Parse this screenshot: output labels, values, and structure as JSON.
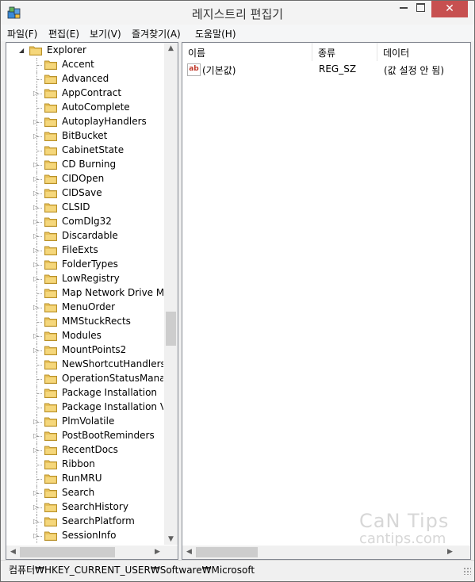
{
  "window": {
    "title": "레지스트리 편집기",
    "close_symbol": "✕"
  },
  "menu": [
    {
      "label": "파일(F)"
    },
    {
      "label": "편집(E)"
    },
    {
      "label": "보기(V)"
    },
    {
      "label": "즐겨찾기(A)"
    },
    {
      "label": "도움말(H)"
    }
  ],
  "tree": {
    "root": {
      "label": "Explorer",
      "expanded": true
    },
    "children": [
      {
        "label": "Accent",
        "expandable": false
      },
      {
        "label": "Advanced",
        "expandable": false
      },
      {
        "label": "AppContract",
        "expandable": true
      },
      {
        "label": "AutoComplete",
        "expandable": false
      },
      {
        "label": "AutoplayHandlers",
        "expandable": true
      },
      {
        "label": "BitBucket",
        "expandable": true
      },
      {
        "label": "CabinetState",
        "expandable": false
      },
      {
        "label": "CD Burning",
        "expandable": true
      },
      {
        "label": "CIDOpen",
        "expandable": true
      },
      {
        "label": "CIDSave",
        "expandable": true
      },
      {
        "label": "CLSID",
        "expandable": true
      },
      {
        "label": "ComDlg32",
        "expandable": true
      },
      {
        "label": "Discardable",
        "expandable": true
      },
      {
        "label": "FileExts",
        "expandable": true
      },
      {
        "label": "FolderTypes",
        "expandable": true
      },
      {
        "label": "LowRegistry",
        "expandable": true
      },
      {
        "label": "Map Network Drive MRU",
        "expandable": false
      },
      {
        "label": "MenuOrder",
        "expandable": true
      },
      {
        "label": "MMStuckRects",
        "expandable": false
      },
      {
        "label": "Modules",
        "expandable": true
      },
      {
        "label": "MountPoints2",
        "expandable": true
      },
      {
        "label": "NewShortcutHandlers",
        "expandable": false
      },
      {
        "label": "OperationStatusManager",
        "expandable": false
      },
      {
        "label": "Package Installation",
        "expandable": false
      },
      {
        "label": "Package Installation Version",
        "expandable": false
      },
      {
        "label": "PlmVolatile",
        "expandable": true
      },
      {
        "label": "PostBootReminders",
        "expandable": true
      },
      {
        "label": "RecentDocs",
        "expandable": true
      },
      {
        "label": "Ribbon",
        "expandable": false
      },
      {
        "label": "RunMRU",
        "expandable": false
      },
      {
        "label": "Search",
        "expandable": true
      },
      {
        "label": "SearchHistory",
        "expandable": true
      },
      {
        "label": "SearchPlatform",
        "expandable": true
      },
      {
        "label": "SessionInfo",
        "expandable": true
      }
    ]
  },
  "list": {
    "columns": [
      "이름",
      "종류",
      "데이터"
    ],
    "rows": [
      {
        "name": "(기본값)",
        "type": "REG_SZ",
        "data": "(값 설정 안 됨)",
        "icon": "string-value-icon",
        "icon_text": "ab"
      }
    ]
  },
  "status": {
    "path": "컴퓨터₩HKEY_CURRENT_USER₩Software₩Microsoft"
  },
  "watermark": {
    "line1": "CaN Tips",
    "line2": "cantips.com"
  },
  "colors": {
    "folder": "#e8c15a",
    "close_button": "#c75050",
    "icon_red": "#c0392b"
  }
}
